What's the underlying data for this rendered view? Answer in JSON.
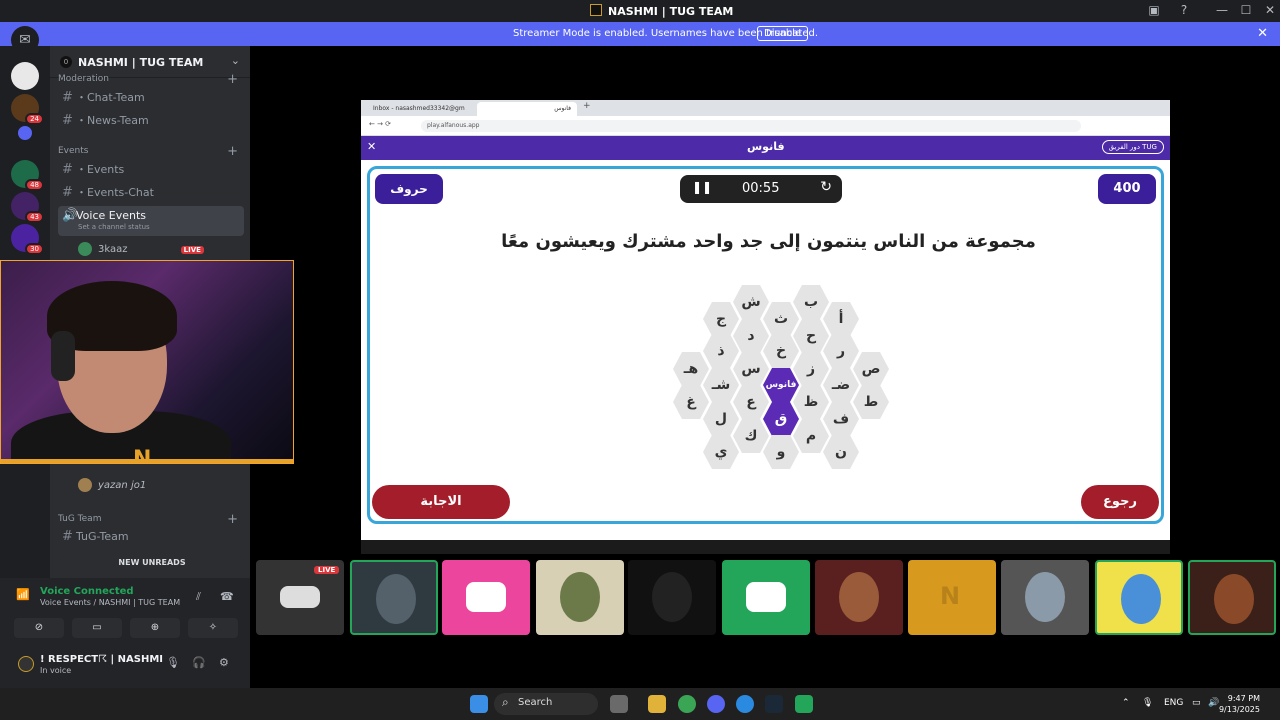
{
  "window": {
    "title": "NASHMI | TUG TEAM"
  },
  "banner": {
    "text": "Streamer Mode is enabled. Usernames have been truncated.",
    "button": "Disable"
  },
  "rail": {
    "badges": [
      "24",
      "48",
      "43",
      "30"
    ]
  },
  "server": {
    "name": "NASHMI | TUG TEAM",
    "badge": "0"
  },
  "channels": {
    "moderation_category": "Moderation",
    "chat_team": "・Chat-Team",
    "news_team": "・News-Team",
    "events_category": "Events",
    "events": "・Events",
    "events_chat": "・Events-Chat",
    "voice_events": "Voice Events",
    "voice_status": "Set a channel status",
    "tug_category": "TuG Team",
    "tug_team": "TuG-Team"
  },
  "voice_users": [
    {
      "name": "3kaaz",
      "live": "LIVE"
    },
    {
      "name": "yazan jo1"
    }
  ],
  "new_unreads": "NEW UNREADS",
  "voice_panel": {
    "status": "Voice Connected",
    "location": "Voice Events / NASHMI | TUG TEAM",
    "username": "! RESPECT☈ | NASHMI",
    "user_status": "In voice"
  },
  "webcam": {
    "logo_letter": "N"
  },
  "browser": {
    "tab1": "Inbox - nasashmed33342@gm",
    "tab2": "فانوس",
    "url": "play.alfanous.app"
  },
  "game": {
    "title": "فانوس",
    "team_button": "دور الفريق TUG",
    "score": "400",
    "letters_button": "حروف",
    "timer": "00:55",
    "question": "مجموعة من الناس ينتمون إلى جد واحد مشترك ويعيشون معًا",
    "answer_button": "الاجابة",
    "back_button": "رجوع",
    "hex_letters": [
      "ش",
      "ب",
      "ج",
      "ث",
      "أ",
      "ذ",
      "د",
      "ح",
      "ر",
      "هـ",
      "خ",
      "س",
      "ز",
      "ص",
      "غ",
      "شـ",
      "فانوس",
      "ضـ",
      "ع",
      "ظ",
      "ط",
      "ل",
      "ق",
      "ف",
      "ك",
      "م",
      "ي",
      "و",
      "ن"
    ]
  },
  "stage": {
    "live_label": "LIVE",
    "tile_logo_letter": "N"
  },
  "taskbar": {
    "search": "Search",
    "lang": "ENG",
    "time": "9:47 PM",
    "date": "9/13/2025"
  },
  "colors": {
    "accent": "#5865f2",
    "game_purple": "#3b1f9a",
    "answer_red": "#a31d2a",
    "live_red": "#da373c",
    "brand_orange": "#e6a229"
  }
}
